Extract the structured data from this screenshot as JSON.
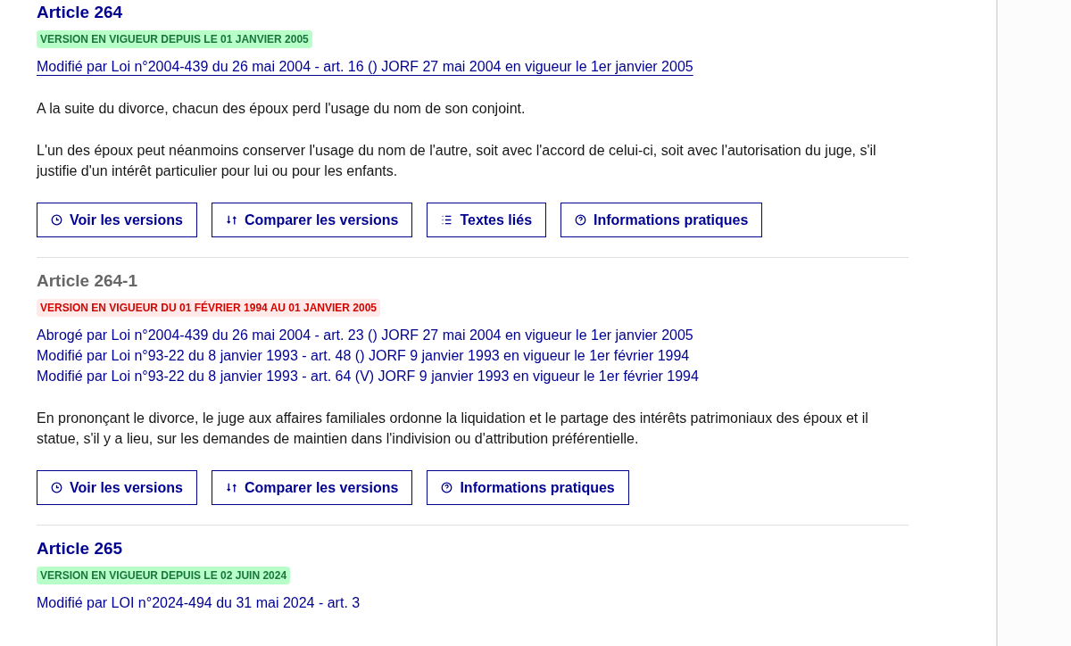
{
  "articles": [
    {
      "title": "Article 264",
      "abrogated": false,
      "badge": "VERSION EN VIGUEUR DEPUIS LE 01 JANVIER 2005",
      "links": [
        {
          "text": "Modifié par Loi n°2004-439 du 26 mai 2004 - art. 16 () JORF 27 mai 2004 en vigueur le 1er janvier 2005",
          "hovered": true
        }
      ],
      "paragraphs": [
        "A la suite du divorce, chacun des époux perd l'usage du nom de son conjoint.",
        "L'un des époux peut néanmoins conserver l'usage du nom de l'autre, soit avec l'accord de celui-ci, soit avec l'autorisation du juge, s'il justifie d'un intérêt particulier pour lui ou pour les enfants."
      ],
      "buttons": [
        {
          "kind": "clock",
          "label": "Voir les versions"
        },
        {
          "kind": "compare",
          "label": "Comparer les versions"
        },
        {
          "kind": "list",
          "label": "Textes liés"
        },
        {
          "kind": "question",
          "label": "Informations pratiques"
        }
      ]
    },
    {
      "title": "Article 264-1",
      "abrogated": true,
      "badge": "VERSION EN VIGUEUR DU 01 FÉVRIER 1994 AU 01 JANVIER 2005",
      "links": [
        {
          "text": "Abrogé par Loi n°2004-439 du 26 mai 2004 - art. 23 () JORF 27 mai 2004 en vigueur le 1er janvier 2005",
          "hovered": false
        },
        {
          "text": "Modifié par Loi n°93-22 du 8 janvier 1993 - art. 48 () JORF 9 janvier 1993 en vigueur le 1er février 1994",
          "hovered": false
        },
        {
          "text": "Modifié par Loi n°93-22 du 8 janvier 1993 - art. 64 (V) JORF 9 janvier 1993 en vigueur le 1er février 1994",
          "hovered": false
        }
      ],
      "paragraphs": [
        "En prononçant le divorce, le juge aux affaires familiales ordonne la liquidation et le partage des intérêts patrimoniaux des époux et il statue, s'il y a lieu, sur les demandes de maintien dans l'indivision ou d'attribution préférentielle."
      ],
      "buttons": [
        {
          "kind": "clock",
          "label": "Voir les versions"
        },
        {
          "kind": "compare",
          "label": "Comparer les versions"
        },
        {
          "kind": "question",
          "label": "Informations pratiques"
        }
      ]
    },
    {
      "title": "Article 265",
      "abrogated": false,
      "badge": "VERSION EN VIGUEUR DEPUIS LE 02 JUIN 2024",
      "links": [
        {
          "text": "Modifié par LOI n°2024-494 du 31 mai 2024 - art. 3",
          "hovered": false
        }
      ]
    }
  ]
}
